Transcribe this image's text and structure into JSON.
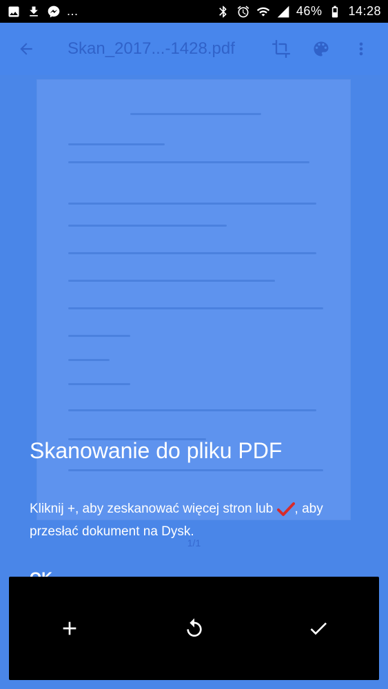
{
  "status_bar": {
    "left_icons": [
      "image-icon",
      "download-icon",
      "messenger-icon"
    ],
    "more_text": "...",
    "right_icons": [
      "bluetooth-icon",
      "alarm-icon",
      "wifi-icon",
      "signal-icon"
    ],
    "battery": "46%",
    "time": "14:28"
  },
  "app_bar": {
    "back_icon": "arrow-back-icon",
    "title": "Skan_2017...-1428.pdf",
    "actions": [
      "crop-icon",
      "palette-icon",
      "more-vert-icon"
    ]
  },
  "document": {
    "page_counter": "1/1"
  },
  "tutorial": {
    "title": "Skanowanie do pliku PDF",
    "body_before": "Kliknij +, aby zeskanować więcej stron lub ",
    "body_after": ", aby przesłać dokument na Dysk.",
    "check_color": "#d62b2b",
    "ok_label": "OK"
  },
  "actions": {
    "add_icon": "plus-icon",
    "rescan_icon": "refresh-icon",
    "confirm_icon": "check-icon"
  },
  "colors": {
    "overlay_blue": "#4a86e8",
    "action_bar": "#000000"
  }
}
